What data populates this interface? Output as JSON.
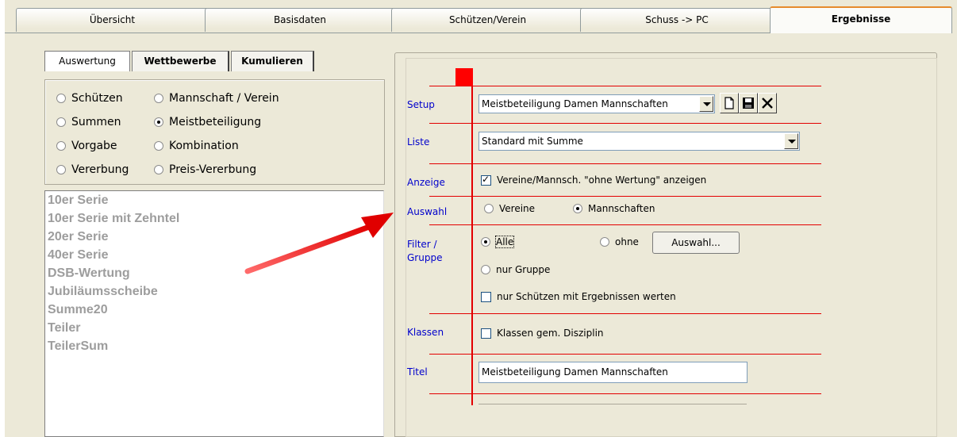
{
  "tabs": [
    {
      "label": "Übersicht"
    },
    {
      "label": "Basisdaten"
    },
    {
      "label": "Schützen/Verein"
    },
    {
      "label": "Schuss -> PC"
    },
    {
      "label": "Ergebnisse"
    }
  ],
  "left": {
    "subtabs": [
      {
        "label": "Auswertung"
      },
      {
        "label": "Wettbewerbe"
      },
      {
        "label": "Kumulieren"
      }
    ],
    "options": [
      {
        "label": "Schützen"
      },
      {
        "label": "Mannschaft / Verein"
      },
      {
        "label": "Summen"
      },
      {
        "label": "Meistbeteiligung"
      },
      {
        "label": "Vorgabe"
      },
      {
        "label": "Kombination"
      },
      {
        "label": "Vererbung"
      },
      {
        "label": "Preis-Vererbung"
      }
    ],
    "selected_option": "Meistbeteiligung",
    "list": [
      "10er Serie",
      "10er Serie mit Zehntel",
      "20er Serie",
      "40er Serie",
      "DSB-Wertung",
      "Jubiläumsscheibe",
      "Summe20",
      "Teiler",
      "TeilerSum"
    ]
  },
  "right": {
    "labels": {
      "setup": "Setup",
      "liste": "Liste",
      "anzeige": "Anzeige",
      "auswahl": "Auswahl",
      "filter": "Filter /",
      "gruppe": "Gruppe",
      "klassen": "Klassen",
      "titel": "Titel"
    },
    "setup_value": "Meistbeteiligung Damen Mannschaften",
    "liste_value": "Standard mit Summe",
    "anzeige_checkbox": "Vereine/Mannsch. \"ohne Wertung\" anzeigen",
    "anzeige_checked": true,
    "auswahl_vereine": "Vereine",
    "auswahl_mannschaften": "Mannschaften",
    "auswahl_selected": "Mannschaften",
    "filter_alle": "Alle",
    "filter_ohne": "ohne",
    "filter_auswahl_button": "Auswahl...",
    "filter_nur_gruppe": "nur Gruppe",
    "filter_selected": "Alle",
    "nur_schuetzen": "nur Schützen mit Ergebnissen werten",
    "nur_schuetzen_checked": false,
    "klassen_checkbox": "Klassen gem. Disziplin",
    "klassen_checked": false,
    "titel_value": "Meistbeteiligung Damen Mannschaften"
  },
  "icons": [
    "new-document-icon",
    "save-icon",
    "delete-icon",
    "dropdown-arrow-icon",
    "red-arrow-annotation"
  ],
  "colors": {
    "label_blue": "#0000cc",
    "guide_red": "#e30000",
    "active_tab_accent": "#e68b2c",
    "window_bg": "#ece9d8"
  }
}
